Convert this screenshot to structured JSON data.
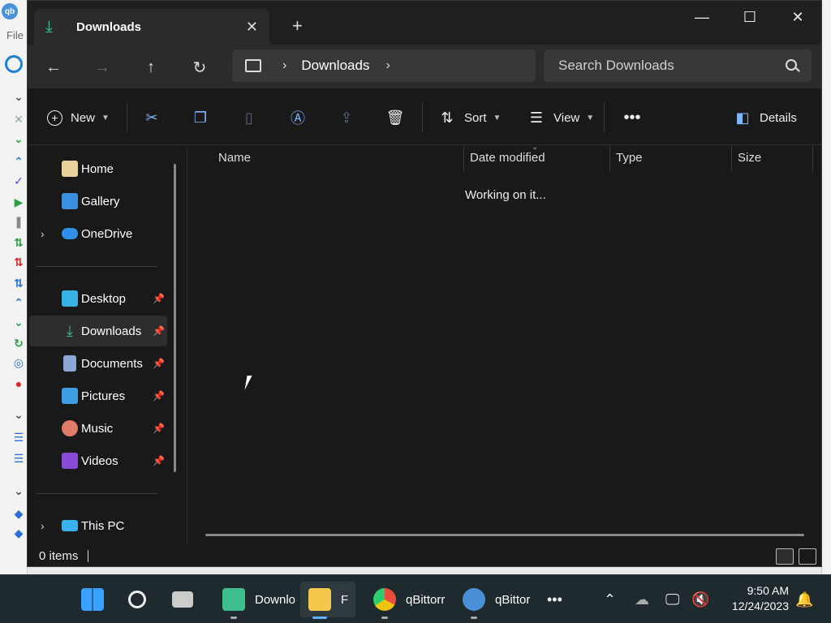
{
  "background_app": {
    "menu_label": "File"
  },
  "window": {
    "tab_title": "Downloads",
    "address": {
      "crumb": "Downloads"
    },
    "search": {
      "placeholder": "Search Downloads"
    }
  },
  "toolbar": {
    "new_label": "New",
    "sort_label": "Sort",
    "view_label": "View",
    "details_label": "Details"
  },
  "sidebar": {
    "items": [
      {
        "label": "Home"
      },
      {
        "label": "Gallery"
      },
      {
        "label": "OneDrive"
      },
      {
        "label": "Desktop"
      },
      {
        "label": "Downloads"
      },
      {
        "label": "Documents"
      },
      {
        "label": "Pictures"
      },
      {
        "label": "Music"
      },
      {
        "label": "Videos"
      },
      {
        "label": "This PC"
      }
    ]
  },
  "columns": {
    "name": "Name",
    "date_modified": "Date modified",
    "type": "Type",
    "size": "Size"
  },
  "content": {
    "loading_text": "Working on it..."
  },
  "status": {
    "items_count": "0 items"
  },
  "taskbar": {
    "apps": [
      {
        "label": "Downlo"
      },
      {
        "label": "F"
      },
      {
        "label": "qBittorr"
      },
      {
        "label": "qBittor"
      }
    ],
    "time": "9:50 AM",
    "date": "12/24/2023"
  },
  "colors": {
    "accent": "#5fb0ff",
    "download_green": "#3fbf8f",
    "window_bg": "#191919",
    "nav_bg": "#2b2b2b"
  }
}
